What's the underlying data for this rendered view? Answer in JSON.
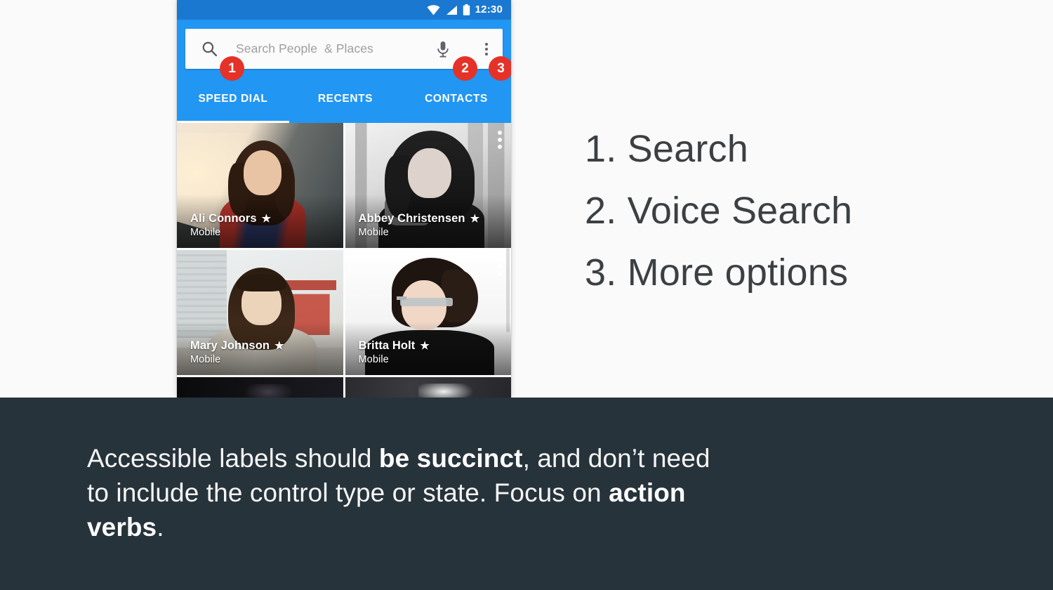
{
  "colors": {
    "page_background": "#fafafa",
    "app_bar_blue": "#2196f3",
    "status_bar_blue": "#1b78d0",
    "badge_red": "#e53228",
    "caption_background": "#27333a",
    "legend_text": "#3c4043",
    "caption_text": "#f5f5f5"
  },
  "phone": {
    "status_bar": {
      "time": "12:30",
      "icons": [
        "wifi-icon",
        "signal-icon",
        "battery-icon"
      ]
    },
    "search": {
      "placeholder": "Search People  & Places",
      "search_icon": "search-icon",
      "mic_icon": "microphone-icon",
      "overflow_icon": "more-options-icon"
    },
    "badges": [
      {
        "label": "1",
        "target": "search-icon"
      },
      {
        "label": "2",
        "target": "microphone-icon"
      },
      {
        "label": "3",
        "target": "more-options-icon"
      }
    ],
    "tabs": [
      {
        "label": "SPEED DIAL",
        "active": true
      },
      {
        "label": "RECENTS",
        "active": false
      },
      {
        "label": "CONTACTS",
        "active": false
      }
    ],
    "contacts": [
      {
        "name": "Ali Connors",
        "star": "★",
        "subtitle": "Mobile",
        "overflow": false
      },
      {
        "name": "Abbey Christensen",
        "star": "★",
        "subtitle": "Mobile",
        "overflow": true
      },
      {
        "name": "Mary Johnson",
        "star": "★",
        "subtitle": "Mobile",
        "overflow": false
      },
      {
        "name": "Britta Holt",
        "star": "★",
        "subtitle": "Mobile",
        "overflow": true
      }
    ]
  },
  "legend": {
    "items": [
      "1. Search",
      "2. Voice Search",
      "3. More options"
    ]
  },
  "caption": {
    "segments": [
      {
        "text": "Accessible labels should ",
        "bold": false
      },
      {
        "text": "be succinct",
        "bold": true
      },
      {
        "text": ", and don’t need to include the control type or state. Focus on ",
        "bold": false
      },
      {
        "text": "action verbs",
        "bold": true
      },
      {
        "text": ".",
        "bold": false
      }
    ],
    "plain_text": "Accessible labels should be succinct, and don’t need to include the control type or state. Focus on action verbs."
  }
}
